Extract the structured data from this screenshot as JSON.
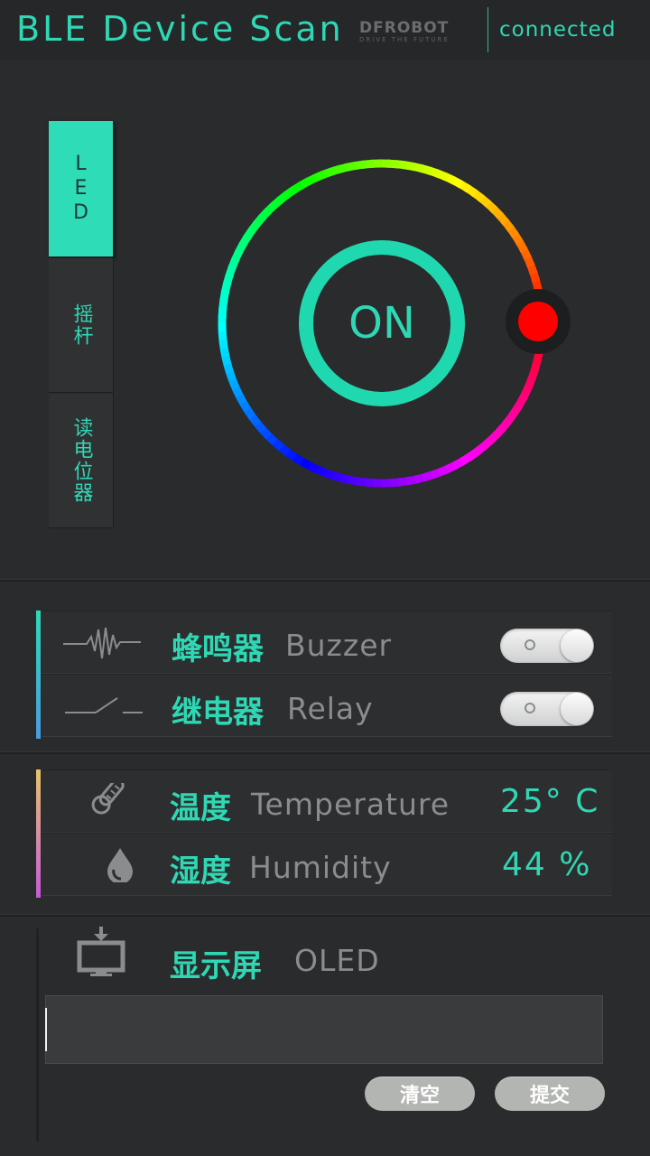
{
  "header": {
    "title": "BLE Device Scan",
    "logo": {
      "word": "DFROBOT",
      "tagline": "DRIVE THE FUTURE"
    },
    "status": "connected"
  },
  "tabs": [
    {
      "label": "LED",
      "active": true
    },
    {
      "label": "摇杆",
      "active": false
    },
    {
      "label": "读电位器",
      "active": false
    }
  ],
  "led": {
    "label": "ON",
    "accent_color": "#2fd8b4",
    "selected_color": "#ff0000"
  },
  "outputs": [
    {
      "icon": "buzzer-icon",
      "cn": "蜂鸣器",
      "en": "Buzzer",
      "on": false
    },
    {
      "icon": "relay-switch-icon",
      "cn": "继电器",
      "en": "Relay",
      "on": false
    }
  ],
  "sensors": [
    {
      "icon": "thermometer-icon",
      "cn": "温度",
      "en": "Temperature",
      "value": "25° C"
    },
    {
      "icon": "water-drop-icon",
      "cn": "湿度",
      "en": "Humidity",
      "value": "44 %"
    }
  ],
  "oled": {
    "icon": "monitor-download-icon",
    "cn": "显示屏",
    "en": "OLED",
    "input_value": "",
    "clear_label": "清空",
    "submit_label": "提交"
  }
}
